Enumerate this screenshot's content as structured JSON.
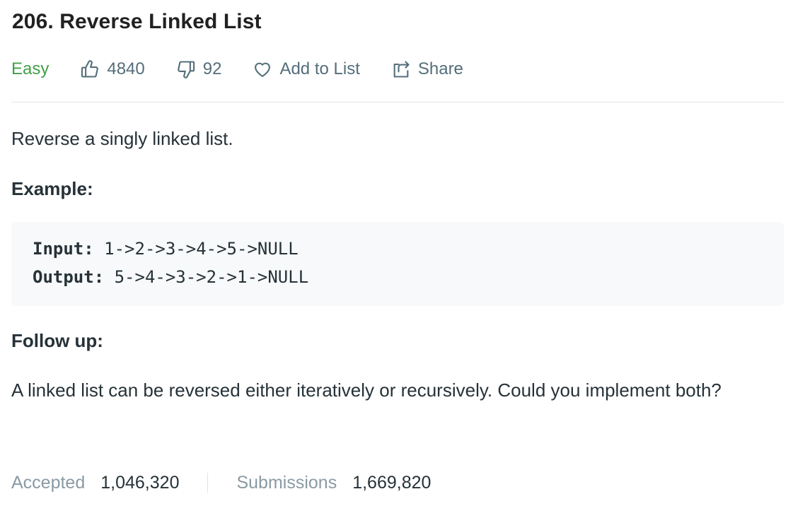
{
  "problem": {
    "title": "206. Reverse Linked List",
    "difficulty": "Easy",
    "likes": "4840",
    "dislikes": "92",
    "add_to_list_label": "Add to List",
    "share_label": "Share"
  },
  "icons": {
    "like": "thumbs-up-icon",
    "dislike": "thumbs-down-icon",
    "add_to_list": "heart-icon",
    "share": "share-icon"
  },
  "colors": {
    "difficulty_easy": "#43a047",
    "text": "#263238",
    "muted": "#546e7a",
    "code_bg": "#f7f9fa"
  },
  "description": {
    "intro": "Reverse a singly linked list.",
    "example_heading": "Example:",
    "example": {
      "input_label": "Input:",
      "input_value": " 1->2->3->4->5->NULL",
      "output_label": "Output:",
      "output_value": " 5->4->3->2->1->NULL"
    },
    "follow_up_heading": "Follow up:",
    "follow_up_text": "A linked list can be reversed either iteratively or recursively. Could you implement both?"
  },
  "stats": {
    "accepted_label": "Accepted",
    "accepted_value": "1,046,320",
    "submissions_label": "Submissions",
    "submissions_value": "1,669,820"
  }
}
